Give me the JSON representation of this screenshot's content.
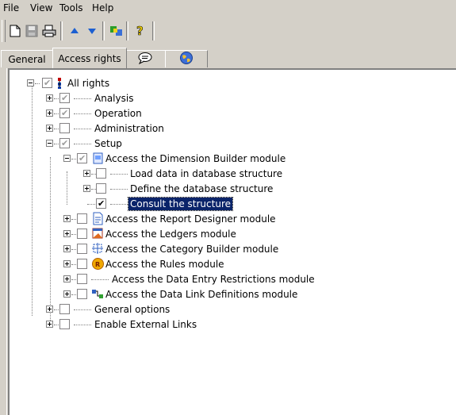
{
  "menu": {
    "items": [
      {
        "id": "file",
        "label": "File"
      },
      {
        "id": "view",
        "label": "View"
      },
      {
        "id": "tools",
        "label": "Tools"
      },
      {
        "id": "help",
        "label": "Help"
      }
    ]
  },
  "toolbar": {
    "buttons": [
      "new-document-icon",
      "save-icon",
      "print-icon",
      "arrow-up-icon",
      "arrow-down-icon",
      "users-icon",
      "help-icon"
    ]
  },
  "tabs": [
    {
      "id": "general",
      "label": "General",
      "active": false
    },
    {
      "id": "access-rights",
      "label": "Access rights",
      "active": true
    },
    {
      "id": "comments",
      "icon": "speech-bubble-icon",
      "active": false
    },
    {
      "id": "globe",
      "icon": "globe-icon",
      "active": false
    }
  ],
  "tree": {
    "root": {
      "label": "All rights",
      "checked": "grey",
      "icon": "hierarchy-icon"
    },
    "nodes": [
      {
        "id": "analysis",
        "label": "Analysis",
        "checked": "grey"
      },
      {
        "id": "operation",
        "label": "Operation",
        "checked": "grey"
      },
      {
        "id": "administration",
        "label": "Administration",
        "checked": "none"
      },
      {
        "id": "setup",
        "label": "Setup",
        "checked": "grey"
      },
      {
        "id": "dimension-builder",
        "label": "Access the Dimension Builder module",
        "checked": "grey",
        "icon": "dimension-builder-icon"
      },
      {
        "id": "load-data",
        "label": "Load data in database structure",
        "checked": "none"
      },
      {
        "id": "define-db",
        "label": "Define the database structure",
        "checked": "none"
      },
      {
        "id": "consult-structure",
        "label": "Consult the structure",
        "checked": "checked",
        "selected": true
      },
      {
        "id": "report-designer",
        "label": "Access the Report Designer module",
        "checked": "none",
        "icon": "report-designer-icon"
      },
      {
        "id": "ledgers",
        "label": "Access the Ledgers module",
        "checked": "none",
        "icon": "ledgers-icon"
      },
      {
        "id": "category-builder",
        "label": "Access the Category Builder module",
        "checked": "none",
        "icon": "category-builder-icon"
      },
      {
        "id": "rules",
        "label": "Access the Rules module",
        "checked": "none",
        "icon": "rules-icon"
      },
      {
        "id": "data-entry-restrictions",
        "label": "Access the Data Entry Restrictions module",
        "checked": "none"
      },
      {
        "id": "data-link-definitions",
        "label": "Access the Data Link Definitions module",
        "checked": "none",
        "icon": "data-link-icon"
      },
      {
        "id": "general-options",
        "label": "General options",
        "checked": "none"
      },
      {
        "id": "external-links",
        "label": "Enable External Links",
        "checked": "none"
      }
    ]
  }
}
